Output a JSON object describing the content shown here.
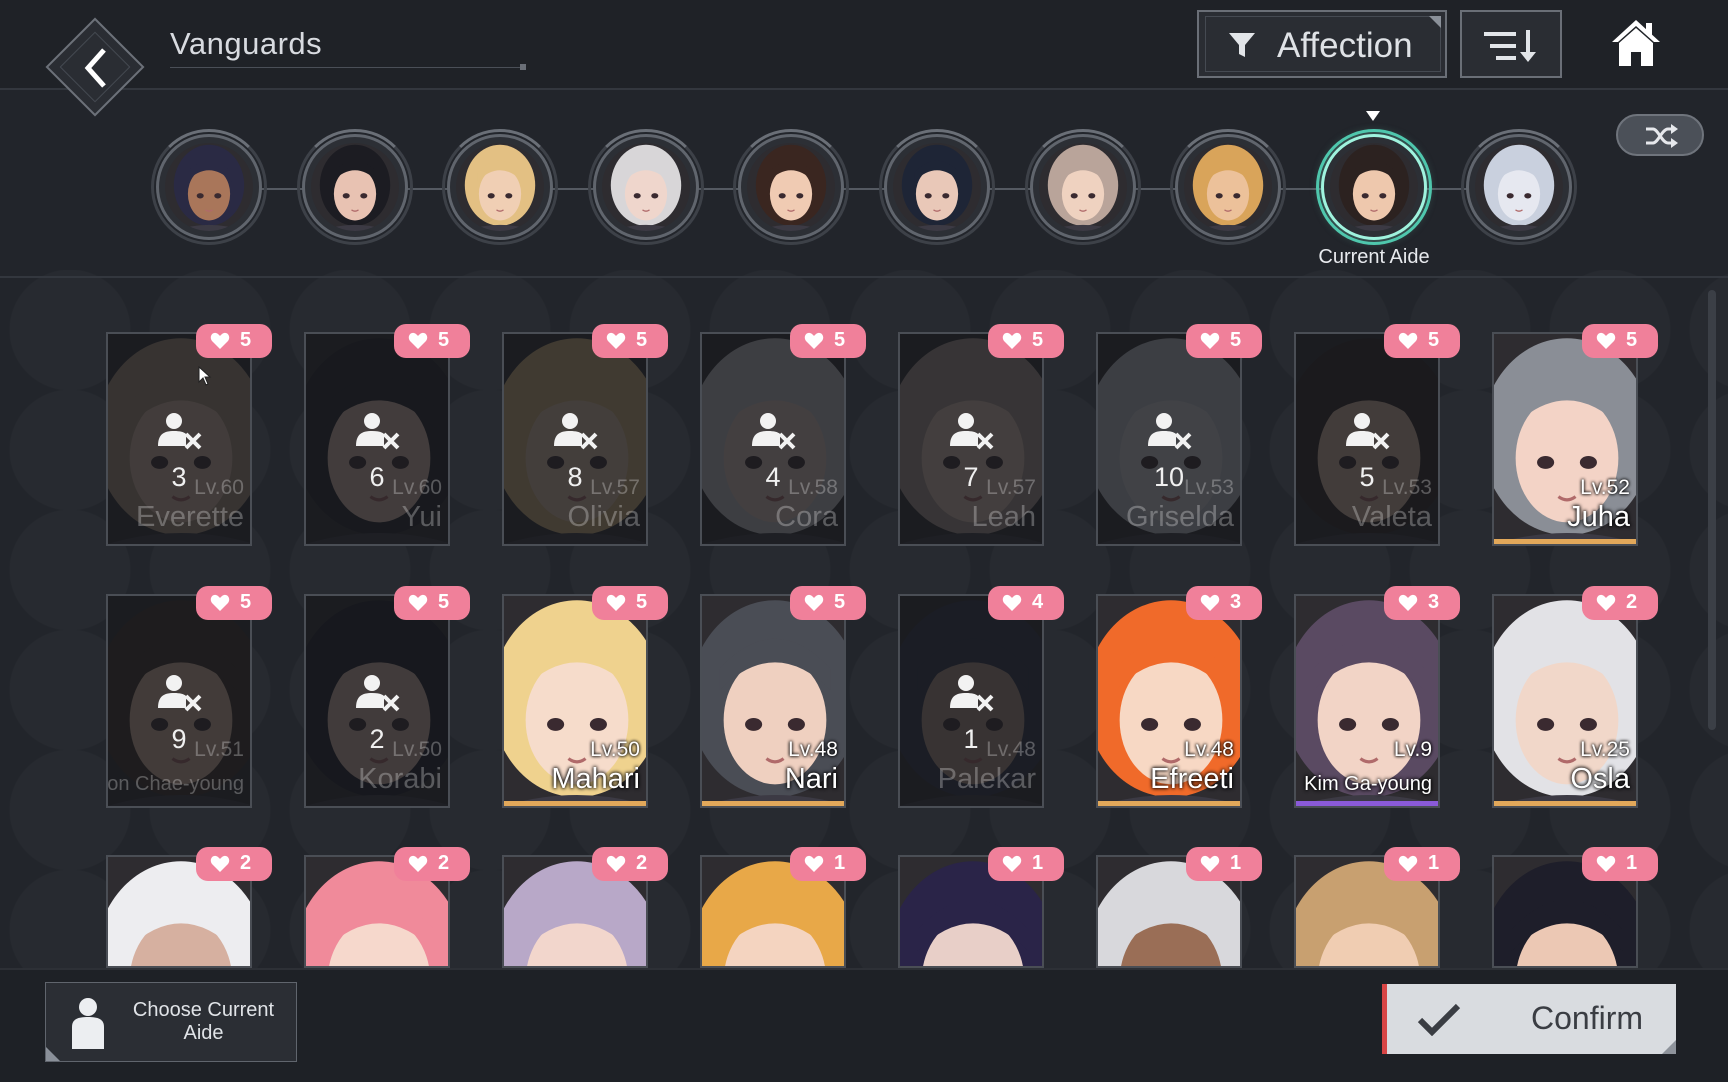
{
  "header": {
    "title": "Vanguards",
    "filter_label": "Affection",
    "back_icon": "back-arrow-icon",
    "sort_icon": "sort-descending-icon",
    "home_icon": "home-icon"
  },
  "aide_strip": {
    "current_label": "Current Aide",
    "current_index": 8,
    "portraits": [
      {
        "skin": "#a9765a",
        "hair": "#2a2a44"
      },
      {
        "skin": "#e8c2b2",
        "hair": "#1c1c22"
      },
      {
        "skin": "#f0cfb4",
        "hair": "#e3c083"
      },
      {
        "skin": "#efd6cc",
        "hair": "#d8d6d8"
      },
      {
        "skin": "#f0cbb3",
        "hair": "#3a2620"
      },
      {
        "skin": "#e9c8b8",
        "hair": "#1e2536"
      },
      {
        "skin": "#efd2c0",
        "hair": "#b9a49a"
      },
      {
        "skin": "#ecc19a",
        "hair": "#d9a45a"
      },
      {
        "skin": "#eec8ad",
        "hair": "#2c2220"
      },
      {
        "skin": "#e6e8f0",
        "hair": "#c9d0de"
      }
    ]
  },
  "cards": [
    {
      "name": "Everette",
      "level": "Lv.60",
      "affection": "5",
      "locked": true,
      "count": "3",
      "hair": "#b39a80",
      "skin": "#e8c8b0"
    },
    {
      "name": "Yui",
      "level": "Lv.60",
      "affection": "5",
      "locked": true,
      "count": "6",
      "hair": "#1d1d24",
      "skin": "#e9c6b6"
    },
    {
      "name": "Olivia",
      "level": "Lv.57",
      "affection": "5",
      "locked": true,
      "count": "8",
      "hair": "#e2bf82",
      "skin": "#f0cfb4"
    },
    {
      "name": "Cora",
      "level": "Lv.58",
      "affection": "5",
      "locked": true,
      "count": "4",
      "hair": "#d4d2d6",
      "skin": "#efd6cc"
    },
    {
      "name": "Leah",
      "level": "Lv.57",
      "affection": "5",
      "locked": true,
      "count": "7",
      "hair": "#b7a397",
      "skin": "#efd2c0"
    },
    {
      "name": "Griselda",
      "level": "Lv.53",
      "affection": "5",
      "locked": true,
      "count": "10",
      "hair": "#cfd3da",
      "skin": "#e6e4ea"
    },
    {
      "name": "Valeta",
      "level": "Lv.53",
      "affection": "5",
      "locked": true,
      "count": "5",
      "hair": "#2c2220",
      "skin": "#eec8ad"
    },
    {
      "name": "Juha",
      "level": "Lv.52",
      "affection": "5",
      "locked": false,
      "count": "",
      "hair": "#8a8e96",
      "skin": "#f3d3c6",
      "bar": "#e2a85a"
    },
    {
      "name": "Yeon Chae-young",
      "level": "Lv.51",
      "affection": "5",
      "locked": true,
      "count": "9",
      "hair": "#3a2a22",
      "skin": "#e8c4a8",
      "small": true
    },
    {
      "name": "Korabi",
      "level": "Lv.50",
      "affection": "5",
      "locked": true,
      "count": "2",
      "hair": "#1a1a22",
      "skin": "#e6c2b2"
    },
    {
      "name": "Mahari",
      "level": "Lv.50",
      "affection": "5",
      "locked": false,
      "count": "",
      "hair": "#efd28e",
      "skin": "#f6dccb",
      "bar": "#e2a85a"
    },
    {
      "name": "Nari",
      "level": "Lv.48",
      "affection": "5",
      "locked": false,
      "count": "",
      "hair": "#4a4d55",
      "skin": "#efd0c0",
      "bar": "#e2a85a"
    },
    {
      "name": "Palekar",
      "level": "Lv.48",
      "affection": "4",
      "locked": true,
      "count": "1",
      "hair": "#2a3046",
      "skin": "#b89a8a"
    },
    {
      "name": "Efreeti",
      "level": "Lv.48",
      "affection": "3",
      "locked": false,
      "count": "",
      "hair": "#f06a2a",
      "skin": "#f7d8c4",
      "bar": "#e2a85a"
    },
    {
      "name": "Kim Ga-young",
      "level": "Lv.9",
      "affection": "3",
      "locked": false,
      "count": "",
      "hair": "#5a4a62",
      "skin": "#f2d4c6",
      "bar": "#8a5ad8",
      "small": true
    },
    {
      "name": "Osla",
      "level": "Lv.25",
      "affection": "2",
      "locked": false,
      "count": "",
      "hair": "#e2e2e6",
      "skin": "#f1d7c9",
      "bar": "#e2a85a"
    },
    {
      "name": "",
      "level": "",
      "affection": "2",
      "locked": false,
      "count": "",
      "hair": "#ededf0",
      "skin": "#d6b0a0"
    },
    {
      "name": "",
      "level": "",
      "affection": "2",
      "locked": false,
      "count": "",
      "hair": "#f08a9a",
      "skin": "#f6d8cc"
    },
    {
      "name": "",
      "level": "",
      "affection": "2",
      "locked": false,
      "count": "",
      "hair": "#b8a8c8",
      "skin": "#f2d6cc"
    },
    {
      "name": "",
      "level": "",
      "affection": "1",
      "locked": false,
      "count": "",
      "hair": "#e8a848",
      "skin": "#f4d4c0"
    },
    {
      "name": "",
      "level": "",
      "affection": "1",
      "locked": false,
      "count": "",
      "hair": "#2a2448",
      "skin": "#e8cfc8"
    },
    {
      "name": "",
      "level": "",
      "affection": "1",
      "locked": false,
      "count": "",
      "hair": "#d8d8dc",
      "skin": "#9a6e56"
    },
    {
      "name": "",
      "level": "",
      "affection": "1",
      "locked": false,
      "count": "",
      "hair": "#c8a070",
      "skin": "#f0cdb2"
    },
    {
      "name": "",
      "level": "",
      "affection": "1",
      "locked": false,
      "count": "",
      "hair": "#1e1e2a",
      "skin": "#ecc8b4"
    }
  ],
  "footer": {
    "choose_label": "Choose Current Aide",
    "confirm_label": "Confirm"
  },
  "colors": {
    "accent_heart": "#f0809a",
    "current_ring": "#9ff3de",
    "confirm_stripe": "#d84545"
  }
}
